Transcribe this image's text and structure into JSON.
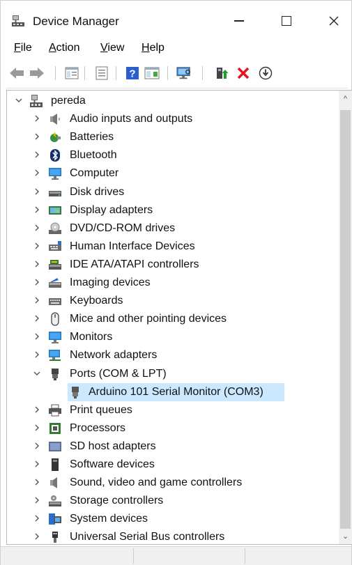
{
  "window": {
    "title": "Device Manager"
  },
  "menu": [
    {
      "prefix": "F",
      "rest": "ile"
    },
    {
      "prefix": "A",
      "rest": "ction"
    },
    {
      "prefix": "V",
      "rest": "iew"
    },
    {
      "prefix": "H",
      "rest": "elp"
    }
  ],
  "toolbar": [
    "back-icon",
    "forward-icon",
    "properties-icon",
    "show-hide-icon",
    "help-icon",
    "show-details-icon",
    "scan-hardware-icon",
    "update-driver-icon",
    "uninstall-icon",
    "download-icon"
  ],
  "tree": {
    "root": "pereda",
    "categories": [
      "Audio inputs and outputs",
      "Batteries",
      "Bluetooth",
      "Computer",
      "Disk drives",
      "Display adapters",
      "DVD/CD-ROM drives",
      "Human Interface Devices",
      "IDE ATA/ATAPI controllers",
      "Imaging devices",
      "Keyboards",
      "Mice and other pointing devices",
      "Monitors",
      "Network adapters",
      "Ports (COM & LPT)",
      "Print queues",
      "Processors",
      "SD host adapters",
      "Software devices",
      "Sound, video and game controllers",
      "Storage controllers",
      "System devices",
      "Universal Serial Bus controllers"
    ],
    "expanded_child": "Arduino 101 Serial Monitor (COM3)"
  },
  "colors": {
    "selection": "#cce8ff",
    "accent": "#0078d7",
    "delete": "#e81123",
    "update": "#107c10"
  }
}
